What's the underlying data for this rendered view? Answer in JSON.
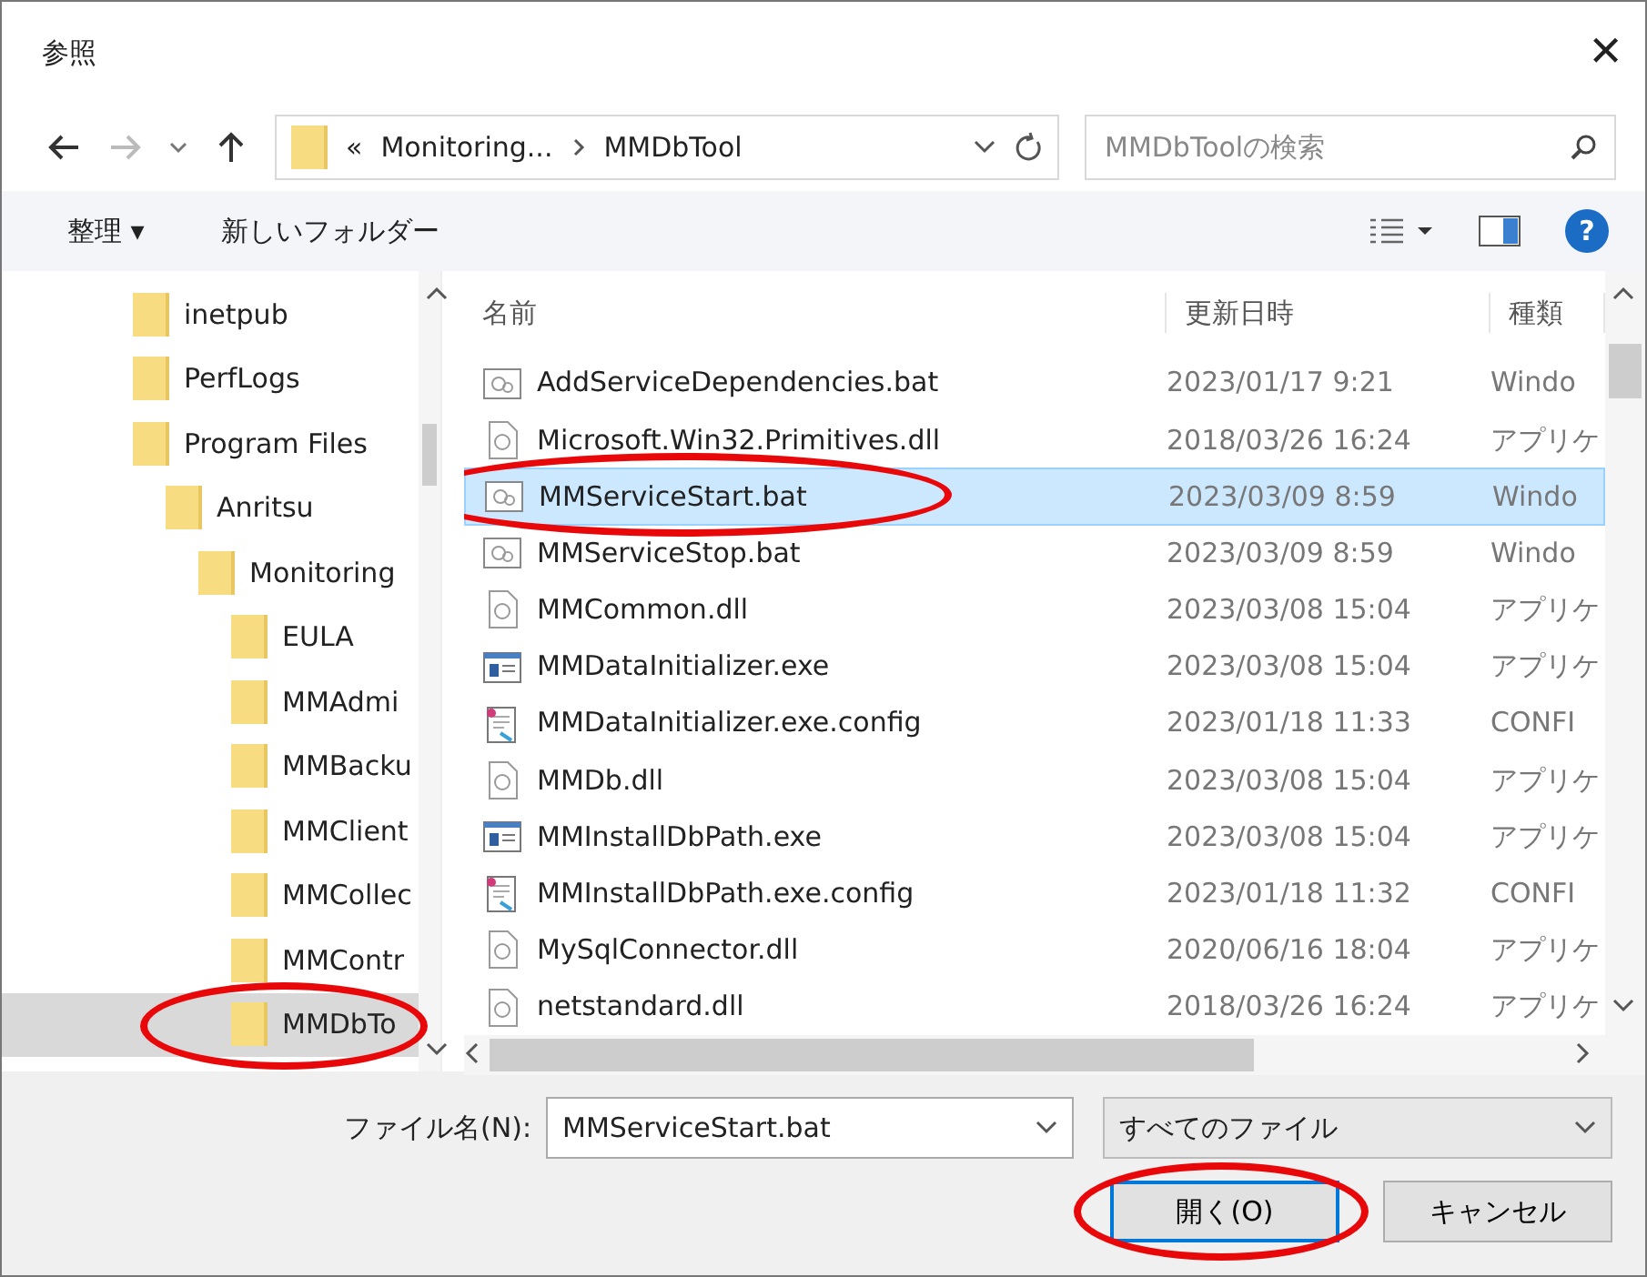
{
  "window": {
    "title": "参照",
    "close": "✕"
  },
  "address": {
    "prefix": "«",
    "path": [
      {
        "label": "Monitoring..."
      },
      {
        "label": "MMDbTool"
      }
    ]
  },
  "search": {
    "placeholder": "MMDbToolの検索"
  },
  "toolbar": {
    "organize": "整理 ▾",
    "new_folder": "新しいフォルダー",
    "help": "?"
  },
  "tree": [
    {
      "label": "inetpub",
      "selected": false,
      "circled": false
    },
    {
      "label": "PerfLogs",
      "selected": false,
      "circled": false
    },
    {
      "label": "Program Files",
      "selected": false,
      "circled": false,
      "children": [
        {
          "label": "Anritsu",
          "selected": false,
          "circled": false,
          "children": [
            {
              "label": "Monitoring",
              "selected": false,
              "circled": false,
              "children": [
                {
                  "label": "EULA",
                  "selected": false,
                  "circled": false
                },
                {
                  "label": "MMAdmi",
                  "selected": false,
                  "circled": false
                },
                {
                  "label": "MMBacku",
                  "selected": false,
                  "circled": false
                },
                {
                  "label": "MMClient",
                  "selected": false,
                  "circled": false
                },
                {
                  "label": "MMCollec",
                  "selected": false,
                  "circled": false
                },
                {
                  "label": "MMContr",
                  "selected": false,
                  "circled": false
                },
                {
                  "label": "MMDbTo",
                  "selected": true,
                  "circled": true
                }
              ]
            }
          ]
        }
      ]
    }
  ],
  "table": {
    "columns": [
      "名前",
      "更新日時",
      "種類"
    ],
    "rows": [
      {
        "kind": "bat",
        "name": "AddServiceDependencies.bat",
        "date": "2023/01/17 9:21",
        "type": "Windo",
        "selected": false,
        "circled": false
      },
      {
        "kind": "dll",
        "name": "Microsoft.Win32.Primitives.dll",
        "date": "2018/03/26 16:24",
        "type": "アプリケ",
        "selected": false,
        "circled": false
      },
      {
        "kind": "bat",
        "name": "MMServiceStart.bat",
        "date": "2023/03/09 8:59",
        "type": "Windo",
        "selected": true,
        "circled": true
      },
      {
        "kind": "bat",
        "name": "MMServiceStop.bat",
        "date": "2023/03/09 8:59",
        "type": "Windo",
        "selected": false,
        "circled": false
      },
      {
        "kind": "dll",
        "name": "MMCommon.dll",
        "date": "2023/03/08 15:04",
        "type": "アプリケ",
        "selected": false,
        "circled": false
      },
      {
        "kind": "exe",
        "name": "MMDataInitializer.exe",
        "date": "2023/03/08 15:04",
        "type": "アプリケ",
        "selected": false,
        "circled": false
      },
      {
        "kind": "config",
        "name": "MMDataInitializer.exe.config",
        "date": "2023/01/18 11:33",
        "type": "CONFI",
        "selected": false,
        "circled": false
      },
      {
        "kind": "dll",
        "name": "MMDb.dll",
        "date": "2023/03/08 15:04",
        "type": "アプリケ",
        "selected": false,
        "circled": false
      },
      {
        "kind": "exe",
        "name": "MMInstallDbPath.exe",
        "date": "2023/03/08 15:04",
        "type": "アプリケ",
        "selected": false,
        "circled": false
      },
      {
        "kind": "config",
        "name": "MMInstallDbPath.exe.config",
        "date": "2023/01/18 11:32",
        "type": "CONFI",
        "selected": false,
        "circled": false
      },
      {
        "kind": "dll",
        "name": "MySqlConnector.dll",
        "date": "2020/06/16 18:04",
        "type": "アプリケ",
        "selected": false,
        "circled": false
      },
      {
        "kind": "dll",
        "name": "netstandard.dll",
        "date": "2018/03/26 16:24",
        "type": "アプリケ",
        "selected": false,
        "circled": false
      }
    ]
  },
  "footer": {
    "filename_label": "ファイル名(N):",
    "filename": "MMServiceStart.bat",
    "filter": "すべてのファイル",
    "buttons": [
      {
        "label": "開く(O)",
        "default": true,
        "circled": true
      },
      {
        "label": "キャンセル",
        "default": false,
        "circled": false
      }
    ]
  }
}
